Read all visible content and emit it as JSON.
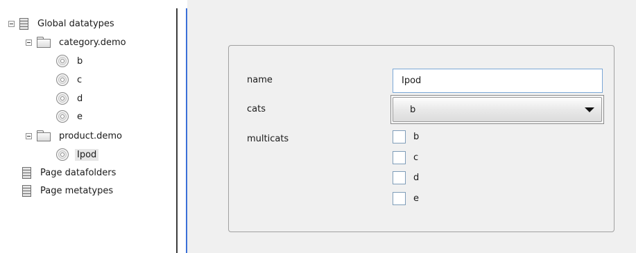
{
  "tree": {
    "root": {
      "label": "Global datatypes",
      "icon": "database-icon",
      "expanded": true
    },
    "category": {
      "label": "category.demo",
      "icon": "folder-icon",
      "expanded": true,
      "items": [
        {
          "label": "b",
          "icon": "disc-icon"
        },
        {
          "label": "c",
          "icon": "disc-icon"
        },
        {
          "label": "d",
          "icon": "disc-icon"
        },
        {
          "label": "e",
          "icon": "disc-icon"
        }
      ]
    },
    "product": {
      "label": "product.demo",
      "icon": "folder-icon",
      "expanded": true,
      "items": [
        {
          "label": "Ipod",
          "icon": "disc-icon",
          "selected": true
        }
      ]
    },
    "page_datafolders": {
      "label": "Page datafolders",
      "icon": "database-icon"
    },
    "page_metatypes": {
      "label": "Page metatypes",
      "icon": "database-icon"
    }
  },
  "form": {
    "name": {
      "label": "name",
      "value": "Ipod"
    },
    "cats": {
      "label": "cats",
      "selected": "b"
    },
    "multicats": {
      "label": "multicats",
      "options": [
        {
          "label": "b",
          "checked": false
        },
        {
          "label": "c",
          "checked": false
        },
        {
          "label": "d",
          "checked": false
        },
        {
          "label": "e",
          "checked": false
        }
      ]
    }
  },
  "colors": {
    "splitter_accent": "#3a6fd8",
    "panel_background": "#f0f0f0",
    "input_border": "#7aa7d6"
  }
}
